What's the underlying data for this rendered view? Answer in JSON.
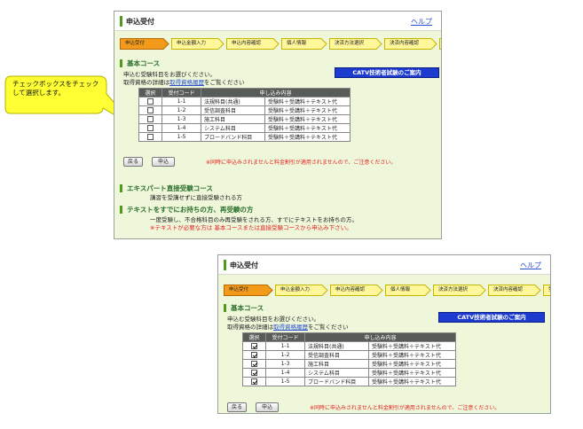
{
  "callout": {
    "text_line1": "チェックボックスをチェック",
    "text_line2": "して選択します。"
  },
  "window": {
    "title": "申込受付",
    "help_label": "ヘルプ"
  },
  "steps": [
    "申込受付",
    "申込金額入力",
    "申込内容確認",
    "個人情報",
    "決済方法選択",
    "決済内容確認",
    "受付完了"
  ],
  "basic_course": {
    "heading": "基本コース",
    "line1": "申込む受験科目をお選びください。",
    "line2_prefix": "取得資格の詳細は",
    "line2_link": "取得資格履歴",
    "line2_suffix": "をご覧ください",
    "catv_button": "CATV技術者試験のご案内"
  },
  "table": {
    "headers": {
      "select": "選択",
      "code": "受付コード",
      "content": "申し込み内容"
    },
    "rows": [
      {
        "code": "1-1",
        "subject": "法規科目(共通)",
        "fee": "受験料＋受講料＋テキスト代"
      },
      {
        "code": "1-2",
        "subject": "受信調査科目",
        "fee": "受験料＋受講料＋テキスト代"
      },
      {
        "code": "1-3",
        "subject": "施工科目",
        "fee": "受験料＋受講料＋テキスト代"
      },
      {
        "code": "1-4",
        "subject": "システム科目",
        "fee": "受験料＋受講料＋テキスト代"
      },
      {
        "code": "1-5",
        "subject": "ブロードバンド科目",
        "fee": "受験料＋受講料＋テキスト代"
      }
    ]
  },
  "buttons": {
    "back": "戻る",
    "apply": "申込"
  },
  "notice": "※同時に申込みされませんと料金割引が適用されませんので、ご注意ください。",
  "expert_course": {
    "heading": "エキスパート直接受験コース",
    "line1": "講習を受講せずに直接受験される方"
  },
  "retake": {
    "heading": "テキストをすでにお持ちの方、再受験の方",
    "line1": "一度受験し、不合格科目のみ再受験をされる方、すでにテキストをお持ちの方。",
    "note": "※テキストが必要な方は 基本コースまたは直接受験コースから申込み下さい。"
  },
  "colors": {
    "panel_bg": "#eef7da",
    "step_active": "#f39a1a",
    "step_inactive": "#fff79a",
    "catv_bg": "#1d3ccf",
    "notice": "#e32020",
    "heading": "#2b6e2b"
  }
}
